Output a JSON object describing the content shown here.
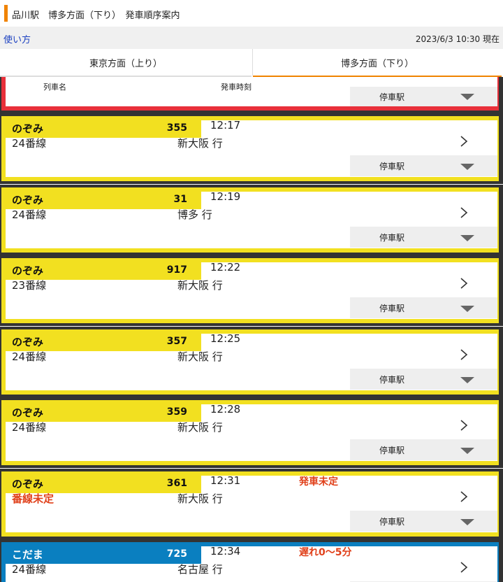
{
  "header": {
    "title": "品川駅　博多方面（下り）　発車順序案内",
    "howto_link": "使い方",
    "current_time": "2023/6/3 10:30 現在"
  },
  "tabs": [
    {
      "label": "東京方面（上り）",
      "selected": false
    },
    {
      "label": "博多方面（下り）",
      "selected": true
    }
  ],
  "columns": {
    "train_name": "列車名",
    "departure_time": "発車時刻"
  },
  "stops_label": "停車駅",
  "colors": {
    "accent": "#f08300",
    "nozomi": "#f2e020",
    "kodama": "#0a7fc0",
    "alert": "#e0401a",
    "partial_card": "#e8303a"
  },
  "trains": [
    {
      "name": "のぞみ",
      "number": "355",
      "time": "12:17",
      "track": "24番線",
      "destination": "新大阪 行",
      "note": "",
      "track_alert": false,
      "type": "nozomi"
    },
    {
      "name": "のぞみ",
      "number": "31",
      "time": "12:19",
      "track": "24番線",
      "destination": "博多 行",
      "note": "",
      "track_alert": false,
      "type": "nozomi"
    },
    {
      "name": "のぞみ",
      "number": "917",
      "time": "12:22",
      "track": "23番線",
      "destination": "新大阪 行",
      "note": "",
      "track_alert": false,
      "type": "nozomi"
    },
    {
      "name": "のぞみ",
      "number": "357",
      "time": "12:25",
      "track": "24番線",
      "destination": "新大阪 行",
      "note": "",
      "track_alert": false,
      "type": "nozomi"
    },
    {
      "name": "のぞみ",
      "number": "359",
      "time": "12:28",
      "track": "24番線",
      "destination": "新大阪 行",
      "note": "",
      "track_alert": false,
      "type": "nozomi"
    },
    {
      "name": "のぞみ",
      "number": "361",
      "time": "12:31",
      "track": "番線未定",
      "destination": "新大阪 行",
      "note": "発車未定",
      "track_alert": true,
      "type": "nozomi"
    },
    {
      "name": "こだま",
      "number": "725",
      "time": "12:34",
      "track": "24番線",
      "destination": "名古屋 行",
      "note": "遅れ0～5分",
      "track_alert": false,
      "type": "kodama"
    }
  ]
}
